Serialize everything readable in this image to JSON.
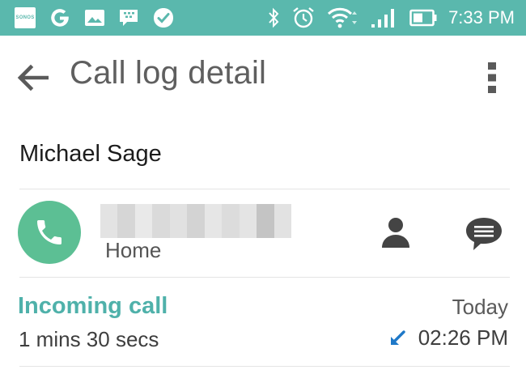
{
  "status_bar": {
    "time": "7:33 PM",
    "notification_icons": [
      "sonos-icon",
      "google-icon",
      "photos-icon",
      "bbm-icon",
      "check-icon"
    ],
    "sonos_label": "SONOS",
    "system_icons": [
      "bluetooth-icon",
      "alarm-icon",
      "wifi-icon",
      "signal-icon",
      "battery-icon"
    ],
    "background_color": "#5ab8ad"
  },
  "app_bar": {
    "title": "Call log detail"
  },
  "contact": {
    "name": "Michael Sage",
    "number_type": "Home",
    "call_button_color": "#5cbf94"
  },
  "call_entry": {
    "type": "Incoming call",
    "duration": "1 mins 30 secs",
    "day": "Today",
    "time": "02:26 PM",
    "type_color": "#4fb1aa",
    "direction_icon": "incoming-arrow-icon",
    "direction_color": "#1e78c8"
  }
}
